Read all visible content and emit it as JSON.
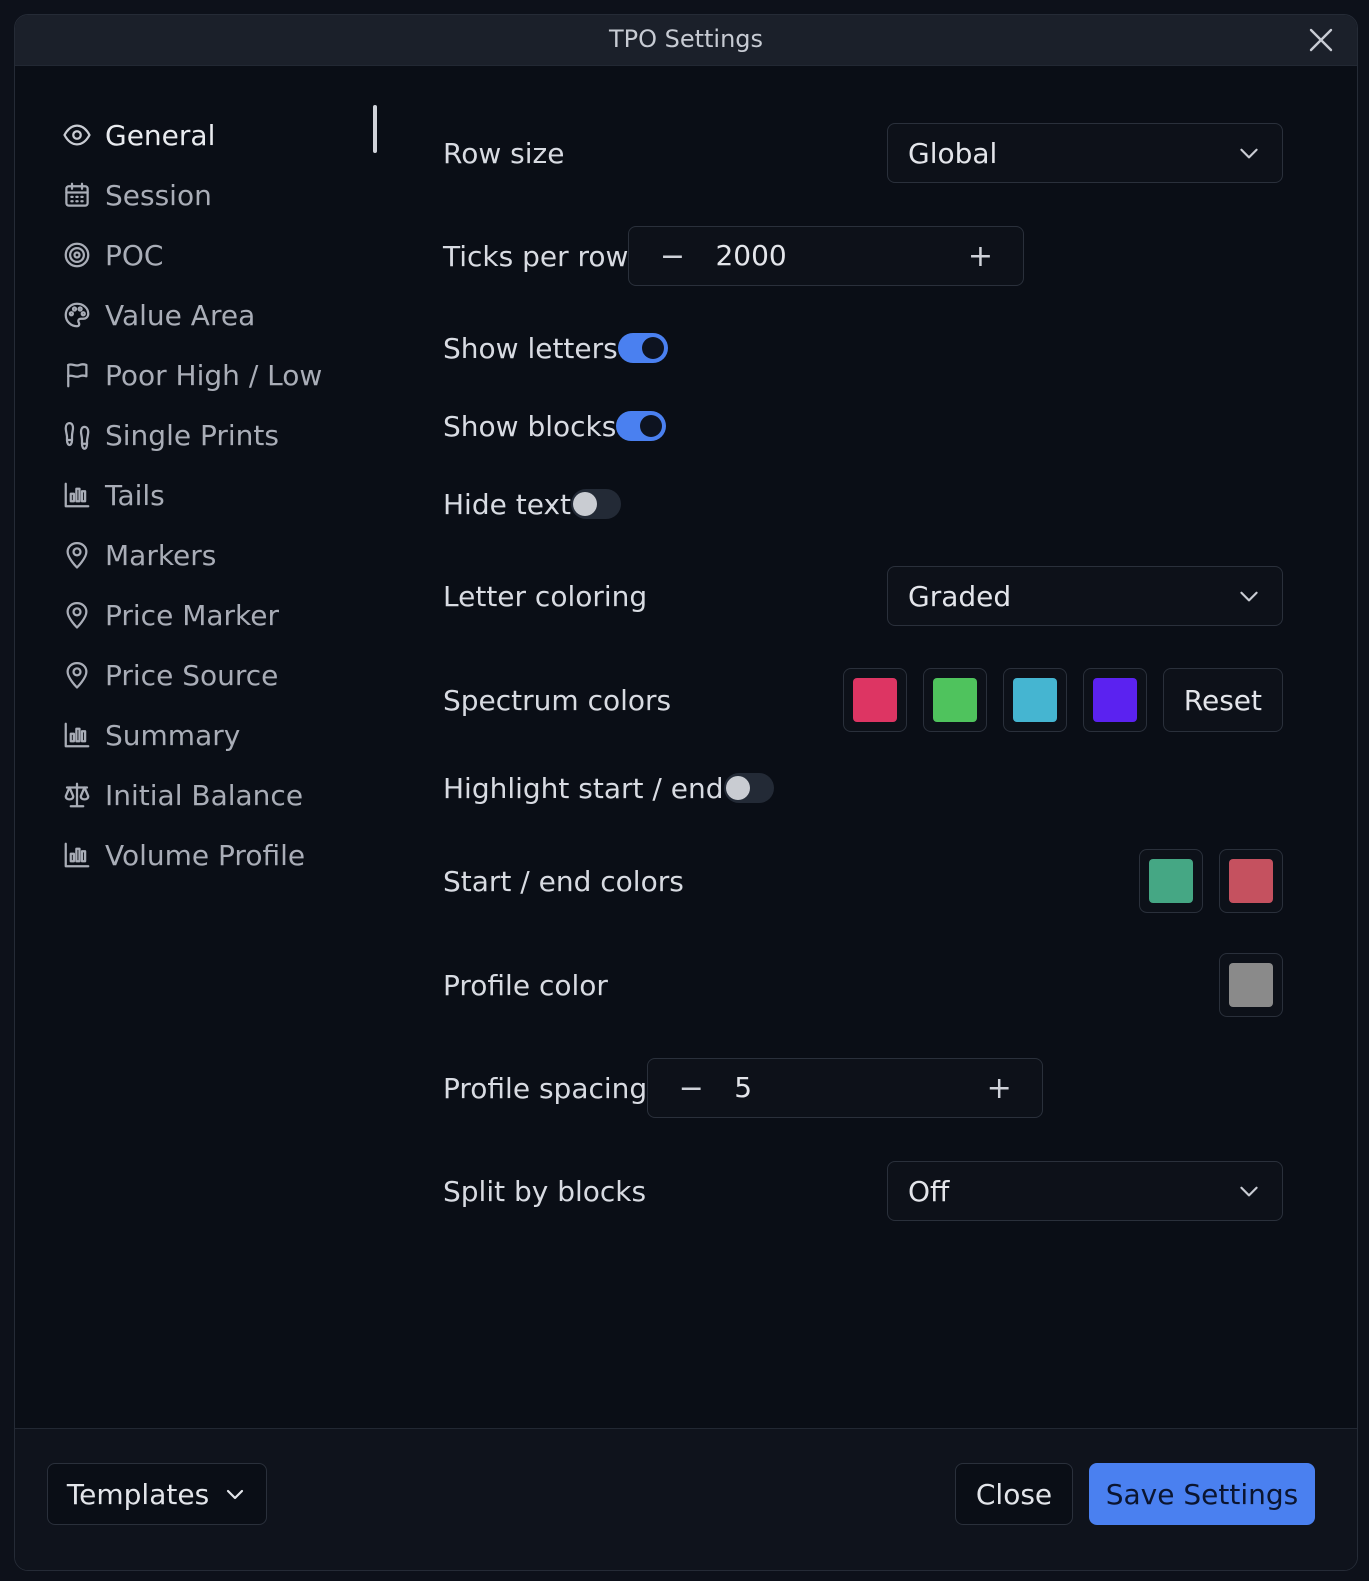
{
  "window": {
    "title": "TPO Settings"
  },
  "sidebar": {
    "items": [
      {
        "label": "General",
        "icon": "eye-icon",
        "active": true
      },
      {
        "label": "Session",
        "icon": "calendar-icon"
      },
      {
        "label": "POC",
        "icon": "target-icon"
      },
      {
        "label": "Value Area",
        "icon": "palette-icon"
      },
      {
        "label": "Poor High / Low",
        "icon": "flag-icon"
      },
      {
        "label": "Single Prints",
        "icon": "footprints-icon"
      },
      {
        "label": "Tails",
        "icon": "bar-chart-icon"
      },
      {
        "label": "Markers",
        "icon": "map-pin-icon"
      },
      {
        "label": "Price Marker",
        "icon": "map-pin-icon"
      },
      {
        "label": "Price Source",
        "icon": "map-pin-icon"
      },
      {
        "label": "Summary",
        "icon": "bar-chart-icon"
      },
      {
        "label": "Initial Balance",
        "icon": "scale-icon"
      },
      {
        "label": "Volume Profile",
        "icon": "bar-chart-icon"
      }
    ]
  },
  "settings": {
    "row_size": {
      "label": "Row size",
      "value": "Global"
    },
    "ticks_per_row": {
      "label": "Ticks per row",
      "value": "2000",
      "minus": "−",
      "plus": "+"
    },
    "show_letters": {
      "label": "Show letters",
      "on": true
    },
    "show_blocks": {
      "label": "Show blocks",
      "on": true
    },
    "hide_text": {
      "label": "Hide text",
      "on": false
    },
    "letter_coloring": {
      "label": "Letter coloring",
      "value": "Graded"
    },
    "spectrum_colors": {
      "label": "Spectrum colors",
      "colors": [
        "#dd3563",
        "#4fc35d",
        "#45b5d1",
        "#5b22f0"
      ],
      "reset_label": "Reset"
    },
    "highlight_start_end": {
      "label": "Highlight start / end",
      "on": false
    },
    "start_end_colors": {
      "label": "Start / end colors",
      "colors": [
        "#45a784",
        "#c5515f"
      ]
    },
    "profile_color": {
      "label": "Profile color",
      "color": "#8a8a8a"
    },
    "profile_spacing": {
      "label": "Profile spacing",
      "value": "5",
      "minus": "−",
      "plus": "+"
    },
    "split_by_blocks": {
      "label": "Split by blocks",
      "value": "Off"
    }
  },
  "footer": {
    "templates_label": "Templates",
    "close_label": "Close",
    "save_label": "Save Settings"
  },
  "colors": {
    "accent": "#4a80f0"
  }
}
